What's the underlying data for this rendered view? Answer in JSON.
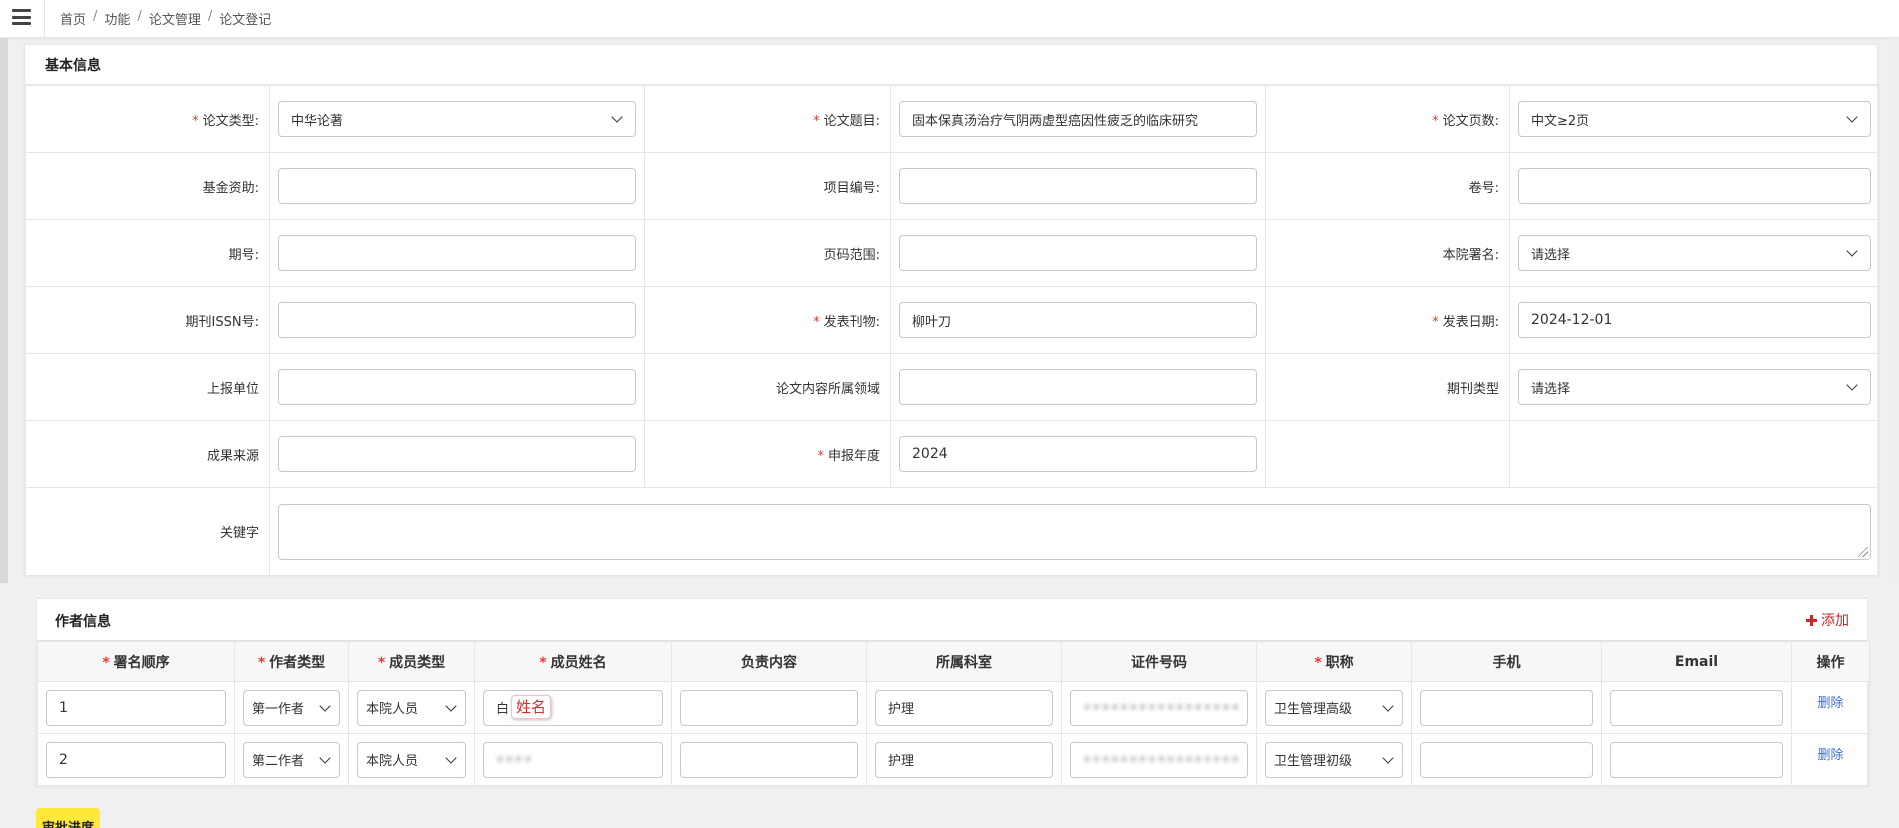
{
  "breadcrumb": [
    "首页",
    "功能",
    "论文管理",
    "论文登记"
  ],
  "basic": {
    "title": "基本信息",
    "paper_type": {
      "label": "论文类型:",
      "value": "中华论著"
    },
    "paper_title": {
      "label": "论文题目:",
      "value": "固本保真汤治疗气阴两虚型癌因性疲乏的临床研究"
    },
    "page_count": {
      "label": "论文页数:",
      "value": "中文≥2页"
    },
    "fund": {
      "label": "基金资助:",
      "value": ""
    },
    "project_no": {
      "label": "项目编号:",
      "value": ""
    },
    "volume": {
      "label": "卷号:",
      "value": ""
    },
    "issue": {
      "label": "期号:",
      "value": ""
    },
    "page_range": {
      "label": "页码范围:",
      "value": ""
    },
    "hospital_sign": {
      "label": "本院署名:",
      "value": "请选择"
    },
    "issn": {
      "label": "期刊ISSN号:",
      "value": ""
    },
    "journal": {
      "label": "发表刊物:",
      "value": "柳叶刀"
    },
    "publish_date": {
      "label": "发表日期:",
      "value": "2024-12-01"
    },
    "report_unit": {
      "label": "上报单位",
      "value": ""
    },
    "content_field": {
      "label": "论文内容所属领域",
      "value": ""
    },
    "journal_type": {
      "label": "期刊类型",
      "value": "请选择"
    },
    "source": {
      "label": "成果来源",
      "value": ""
    },
    "report_year": {
      "label": "申报年度",
      "value": "2024"
    },
    "keywords": {
      "label": "关键字",
      "value": ""
    }
  },
  "authors": {
    "title": "作者信息",
    "add_label": "添加",
    "columns": [
      "署名顺序",
      "作者类型",
      "成员类型",
      "成员姓名",
      "负责内容",
      "所属科室",
      "证件号码",
      "职称",
      "手机",
      "Email",
      "操作"
    ],
    "rows": [
      {
        "order": "1",
        "author_type": "第一作者",
        "member_type": "本院人员",
        "name": "白",
        "duty": "",
        "dept": "护理",
        "id_no": "•••••••••••••••••",
        "title": "卫生管理高级",
        "phone": "",
        "email": "",
        "action": "删除"
      },
      {
        "order": "2",
        "author_type": "第二作者",
        "member_type": "本院人员",
        "name": "••••",
        "duty": "",
        "dept": "护理",
        "id_no": "•••••••••••••••••",
        "title": "卫生管理初级",
        "phone": "",
        "email": "",
        "action": "删除"
      }
    ],
    "name_badge": "姓名"
  },
  "progress_label": "审批进度",
  "colors": {
    "required": "#e53935",
    "accent": "#c62828",
    "link": "#3a6fd8",
    "progress_btn": "#ffe83a"
  }
}
